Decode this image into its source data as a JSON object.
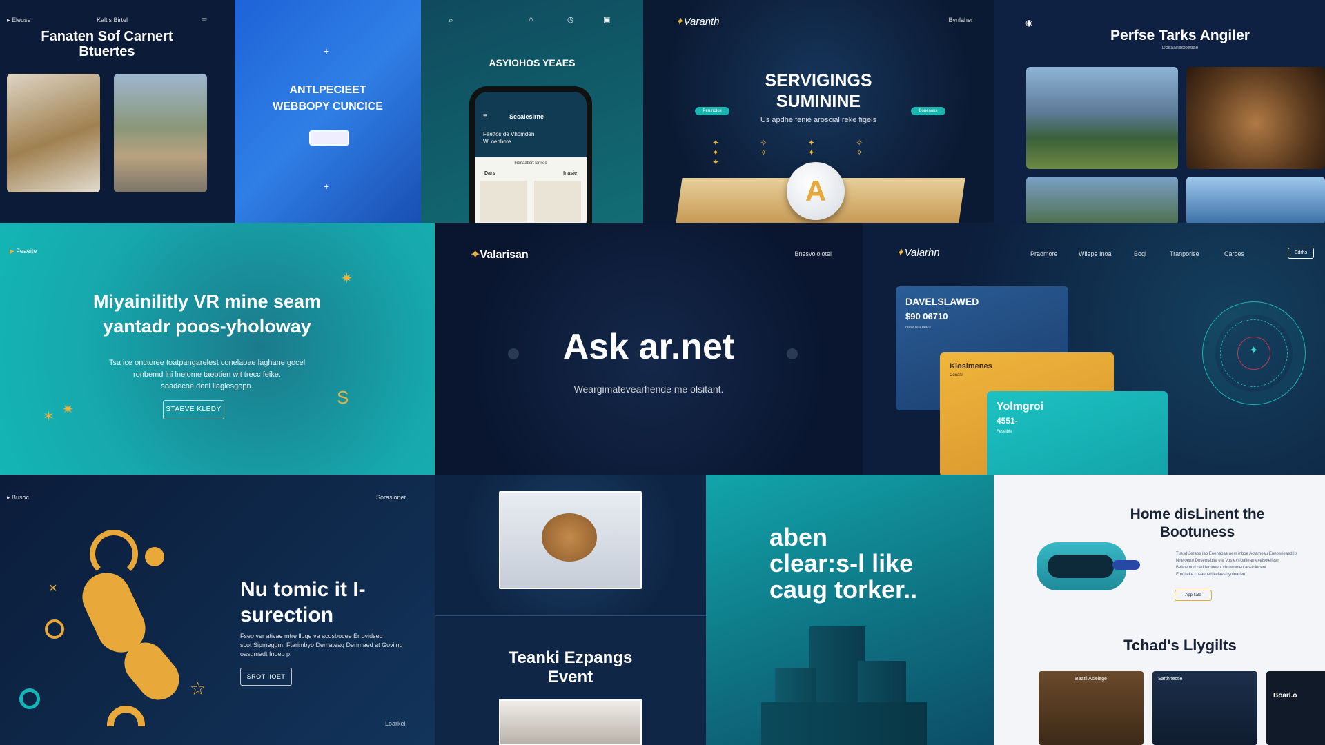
{
  "colors": {
    "navy": "#0b1a33",
    "deep_navy": "#0a1630",
    "blue": "#1f64d6",
    "teal": "#14b5b5",
    "teal_dark": "#0f6f7a",
    "gold": "#e8a93a",
    "white": "#ffffff",
    "panel_white": "#f3f5f8"
  },
  "t1": {
    "nav": "Eleuse",
    "nav_right": "Kaltis Birtel",
    "title_line1": "Fanaten Sof Carnert",
    "title_line2": "Btuertes"
  },
  "t2": {
    "title_line1": "ANTLPECIEET",
    "title_line2": "WEBBOPY CUNCICE"
  },
  "t3": {
    "title": "ASYIOHOS YEAES",
    "phone_header": "Secalesirne",
    "phone_text_line1": "Faettos de Vhomden",
    "phone_text_line2": "Wi oenbote",
    "phone_sub": "Fienaatlert lanliee",
    "phone_tab_left": "Dars",
    "phone_tab_right": "Inasie"
  },
  "t4": {
    "brand": "Varanth",
    "nav_right": "Bynlaher",
    "title_line1": "SERVIGINGS",
    "title_line2": "SUMININE",
    "subtitle": "Us apdhe fenie aroscial reke figeis",
    "pill_left": "Perunotos",
    "pill_right": "Bonenous"
  },
  "t5": {
    "title": "Perfse Tarks Angiler",
    "subtitle": "Dosaanestoatiae"
  },
  "t6": {
    "nav": "Feaeite",
    "title_line1": "Miyainilitly VR mine seam",
    "title_line2": "yantadr poos-yholoway",
    "body_line1": "Tsa ice onctoree toatpangarelest conelaoae laghane gocel",
    "body_line2": "ronbemd lni lneiome taeptien wlt trecc feike.",
    "body_line3": "soadecoe donl llaglesgopn.",
    "cta": "STAEVE KLEDY"
  },
  "t7": {
    "brand": "Valarisan",
    "nav_right": "Bnesvololotel",
    "title": "Ask ar.net",
    "subtitle": "Weargimatevearhende me olsitant."
  },
  "t8": {
    "brand": "Valarhn",
    "nav": [
      "Pradmore",
      "Wilepe Inoa",
      "Boqi",
      "Tranporise",
      "Caroes"
    ],
    "nav_button": "Edrhs",
    "card1_title": "DAVELSLAWED",
    "card1_value": "$90 06710",
    "card1_note": "Newoeadieeu",
    "card2_title": "Kiosimenes",
    "card2_note": "Conalti",
    "card3_title": "Yolmgroi",
    "card3_value": "4551-",
    "card3_note": "Feselbis"
  },
  "t9": {
    "nav": "Busoc",
    "nav_right": "Sorasloner",
    "title_line1": "Nu tomic it I-",
    "title_line2": "surection",
    "body_line1": "Fseo ver ativae mtre lluqe va acosbocee Er ovidsed",
    "body_line2": "scot Sipmeggm. Ftarimbyo Demateag Denmaed at Goviing",
    "body_line3": "oasgmadt fnoeb p.",
    "cta": "SROT IIOET",
    "footer": "Loarkel"
  },
  "t10": {
    "title_line1": "Teanki Ezpangs",
    "title_line2": "Event"
  },
  "t11": {
    "title_line1": "aben",
    "title_line2": "clear:s-l like",
    "title_line3": "caug torker.."
  },
  "t12": {
    "title_line1": "Home disLinent the",
    "title_line2": "Bootuness",
    "body_line1": "Tuesd Jerape lao Eoenabae nem inboe Actameau Eunoerieasd lls",
    "body_line2": "Nneloerto Dosemabite ete Vos exsioaltean exelsolelieen",
    "body_line3": "Beitoemod ceddemoeeni chuiwomen aostoleceni",
    "body_line4": "Emoiteke cosaeoed kelaes ilyolnarlen",
    "cta": "App kale",
    "section_title": "Tchad's Llygilts",
    "card_left": "Baatil Asleiege",
    "card_mid": "Sarthnectie",
    "card_right": "Boarl.o"
  }
}
